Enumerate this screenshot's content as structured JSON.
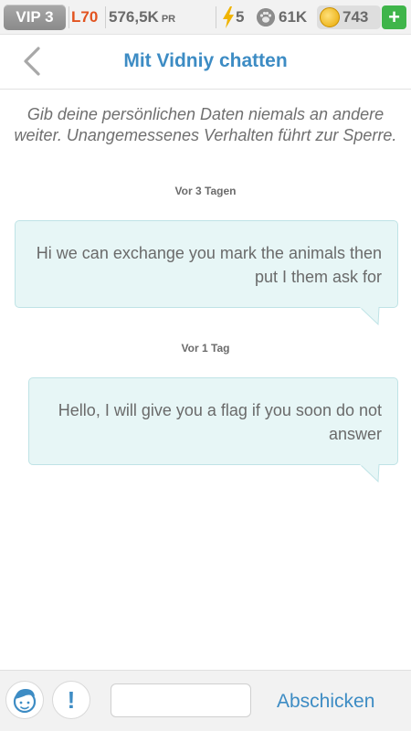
{
  "status_bar": {
    "vip": "VIP 3",
    "level": "L70",
    "power": "576,5K",
    "power_unit": "PR",
    "energy": "5",
    "paws": "61K",
    "coins": "743",
    "add_button": "+"
  },
  "header": {
    "title": "Mit Vidniy chatten"
  },
  "chat": {
    "notice": "Gib deine persönlichen Daten niemals an andere weiter. Unangemessenes Verhalten führt zur Sperre.",
    "messages": [
      {
        "time": "Vor 3 Tagen",
        "text": "Hi we can exchange you mark the animals then put I them ask for"
      },
      {
        "time": "Vor 1 Tag",
        "text": "Hello, I will give you a flag if you soon do not answer"
      }
    ]
  },
  "composer": {
    "input_value": "",
    "send_label": "Abschicken",
    "report_label": "!"
  },
  "colors": {
    "accent": "#3d8cc4",
    "level": "#e2531f",
    "bubble": "#e7f6f6",
    "add": "#3fb54a"
  }
}
